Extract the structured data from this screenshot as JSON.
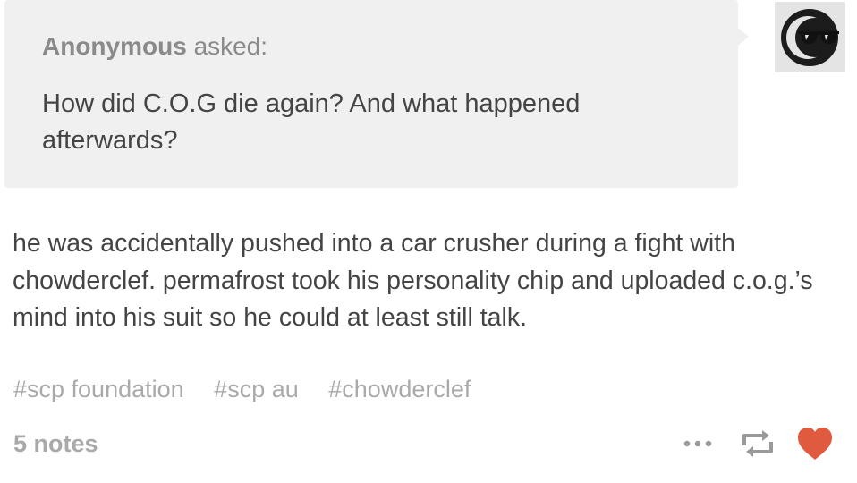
{
  "ask": {
    "asker": "Anonymous",
    "asked_label": "asked:",
    "question": "How did C.O.G die again? And what happened afterwards?"
  },
  "avatar": {
    "icon": "sunglasses-moon-avatar-icon"
  },
  "answer": {
    "text": "he was accidentally pushed into a car crusher during a fight with chowderclef. permafrost took his personality chip and uploaded c.o.g.’s mind into his suit so he could at least still talk."
  },
  "tags": [
    "#scp foundation",
    "#scp au",
    "#chowderclef"
  ],
  "footer": {
    "notes": "5 notes",
    "icons": [
      "more-icon",
      "reblog-icon",
      "like-icon"
    ],
    "like_color": "#e05a3f"
  },
  "colors": {
    "ask_background": "#f0f0f0",
    "text": "#444444",
    "muted": "#a9a9a9"
  }
}
